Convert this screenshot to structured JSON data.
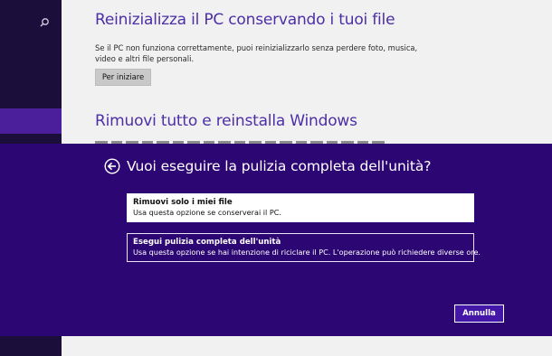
{
  "nav": {
    "icon": "search-icon"
  },
  "background": {
    "reset_title": "Reinizializza il PC conservando i tuoi file",
    "reset_description": "Se il PC non funziona correttamente, puoi reinizializzarlo senza perdere foto, musica, video e altri file personali.",
    "start_button": "Per iniziare",
    "remove_title": "Rimuovi tutto e reinstalla Windows"
  },
  "dialog": {
    "back_icon": "back-arrow-icon",
    "title": "Vuoi eseguire la pulizia completa dell'unità?",
    "options": [
      {
        "title": "Rimuovi solo i miei file",
        "subtitle": "Usa questa opzione se conserverai il PC."
      },
      {
        "title": "Esegui pulizia completa dell'unità",
        "subtitle": "Usa questa opzione se hai intenzione di riciclare il PC. L'operazione può richiedere diverse ore."
      }
    ],
    "cancel_label": "Annulla"
  },
  "colors": {
    "accent_purple": "#4c2fa6",
    "dialog_bg": "#2c0672",
    "nav_bg": "#1b0e3a",
    "nav_selected": "#4b1f9b"
  }
}
